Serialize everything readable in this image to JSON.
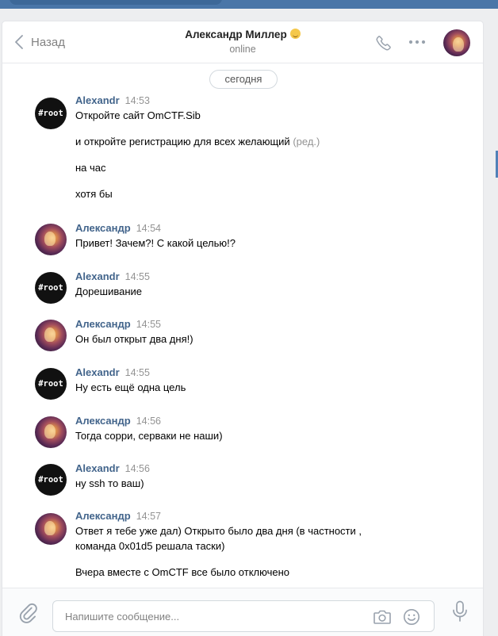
{
  "header": {
    "back_label": "Назад",
    "title": "Александр Миллер",
    "status": "online"
  },
  "date_separator": "сегодня",
  "messages": [
    {
      "author": "Alexandr",
      "time": "14:53",
      "avatar": "root-avatar",
      "lines": [
        "Откройте сайт OmCTF.Sib",
        "и откройте регистрацию для всех желающий",
        "на час",
        "хотя бы"
      ],
      "edited_label": "(ред.)"
    },
    {
      "author": "Александр",
      "time": "14:54",
      "avatar": "photo-avatar",
      "lines": [
        "Привет! Зачем?! С какой целью!?"
      ]
    },
    {
      "author": "Alexandr",
      "time": "14:55",
      "avatar": "root-avatar",
      "lines": [
        "Дорешивание"
      ]
    },
    {
      "author": "Александр",
      "time": "14:55",
      "avatar": "photo-avatar",
      "lines": [
        "Он был открыт два дня!)"
      ]
    },
    {
      "author": "Alexandr",
      "time": "14:55",
      "avatar": "root-avatar",
      "lines": [
        "Ну есть ещё одна цель"
      ]
    },
    {
      "author": "Александр",
      "time": "14:56",
      "avatar": "photo-avatar",
      "lines": [
        "Тогда сорри, серваки не наши)"
      ]
    },
    {
      "author": "Alexandr",
      "time": "14:56",
      "avatar": "root-avatar",
      "lines": [
        "ну ssh то ваш)"
      ]
    },
    {
      "author": "Александр",
      "time": "14:57",
      "avatar": "photo-avatar",
      "lines": [
        "Ответ я тебе уже дал) Открыто было два дня (в частности ,",
        "команда 0x01d5 решала таски)",
        "Вчера вместе с OmCTF все было отключено"
      ]
    }
  ],
  "root_avatar_text": "#root",
  "composer": {
    "placeholder": "Напишите сообщение..."
  },
  "colors": {
    "accent": "#4a76a8",
    "author_link": "#42648b",
    "muted": "#828282"
  }
}
